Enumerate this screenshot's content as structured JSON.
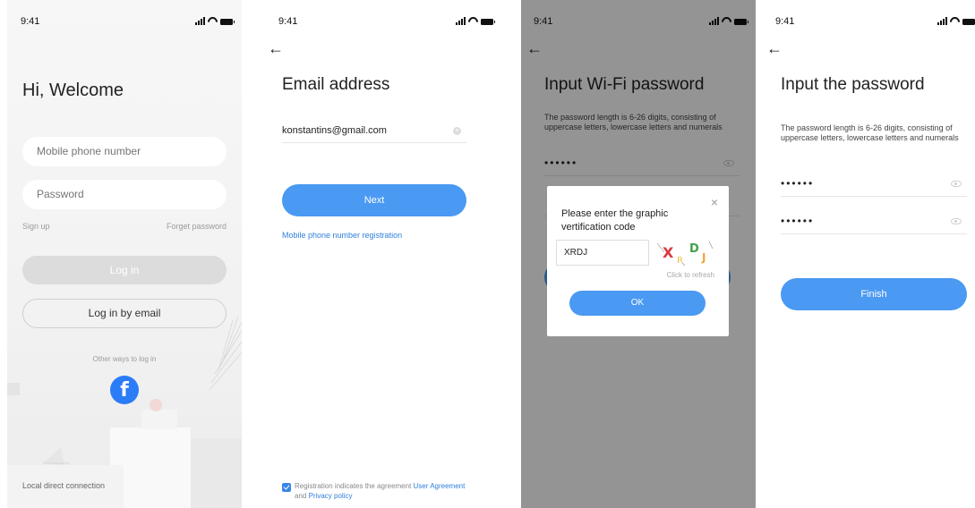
{
  "status": {
    "time": "9:41"
  },
  "login": {
    "welcome": "Hi, Welcome",
    "phone_placeholder": "Mobile phone number",
    "password_placeholder": "Password",
    "sign_up": "Sign up",
    "forget_password": "Forget password",
    "login_button": "Log in",
    "login_email_button": "Log in by email",
    "other_ways": "Other ways to log in",
    "facebook_glyph": "f",
    "local_connection": "Local direct connection"
  },
  "email": {
    "title": "Email address",
    "email_value": "konstantins@gmail.com",
    "next_button": "Next",
    "phone_registration": "Mobile phone number registration",
    "agreement_prefix": "Registration indicates the agreement ",
    "user_agreement": "User Agreement",
    "and": " and ",
    "privacy_policy": "Privacy policy"
  },
  "wifi": {
    "title": "Input Wi-Fi password",
    "description": "The password length is 6-26 digits, consisting of uppercase letters, lowercase letters and numerals",
    "password_masked": "••••••",
    "dialog": {
      "title": "Please enter the graphic vertification code",
      "code_value": "XRDJ",
      "captcha_chars": [
        "X",
        "R",
        "D",
        "J"
      ],
      "refresh": "Click to refresh",
      "ok_button": "OK",
      "close_glyph": "×"
    }
  },
  "password": {
    "title": "Input the password",
    "description": "The password length is 6-26 digits, consisting of uppercase letters, lowercase letters and numerals",
    "password_masked": "••••••",
    "confirm_masked": "••••••",
    "finish_button": "Finish"
  },
  "colors": {
    "primary_blue": "#4a99f2",
    "facebook_blue": "#2a7cf7",
    "disabled_grey": "#dcdcdc"
  }
}
